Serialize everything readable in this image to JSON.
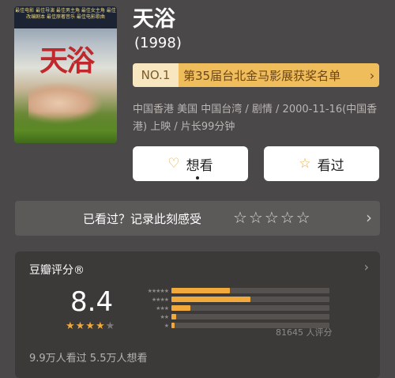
{
  "poster": {
    "title": "天浴",
    "award_lines": "最佳电影 最佳导演 最佳男主角 最佳女主角 最佳改编剧本 最佳原著音乐 最佳电影歌曲"
  },
  "movie": {
    "title": "天浴",
    "year": "(1998)"
  },
  "ranking": {
    "rank": "NO.1",
    "list_name": "第35届台北金马影展获奖名单"
  },
  "meta": "中国香港 美国 中国台湾 / 剧情 / 2000-11-16(中国香港) 上映 / 片长99分钟",
  "actions": {
    "want": "想看",
    "seen": "看过"
  },
  "seen_prompt": {
    "label": "已看过？记录此刻感受"
  },
  "rating": {
    "header": "豆瓣评分®",
    "score": "8.4",
    "stars_on": 4,
    "distribution": [
      0.37,
      0.5,
      0.12,
      0.03,
      0.02
    ],
    "count": "81645 人评分",
    "stats": "9.9万人看过  5.5万人想看"
  },
  "colors": {
    "accent": "#f0a93a",
    "background": "#4a4848"
  }
}
